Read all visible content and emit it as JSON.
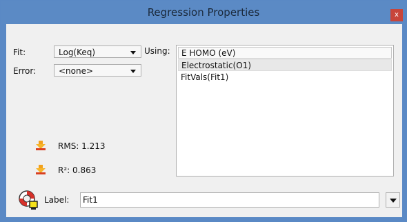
{
  "window": {
    "title": "Regression Properties",
    "close_glyph": "x"
  },
  "fit": {
    "label": "Fit:",
    "selected": "Log(Keq)"
  },
  "error": {
    "label": "Error:",
    "selected": "<none>"
  },
  "using": {
    "label": "Using:",
    "items": [
      "E HOMO (eV)",
      "Electrostatic(O1)",
      "FitVals(Fit1)"
    ]
  },
  "stats": {
    "rms": "RMS: 1.213",
    "r2": "R²: 0.863",
    "icon": "arrow-down-icon"
  },
  "label_field": {
    "label": "Label:",
    "value": "Fit1",
    "icon": "lifebuoy-icon"
  },
  "colors": {
    "titlebar": "#5b8ac5",
    "close": "#c8453a",
    "dialog_bg": "#f0f0f0"
  }
}
